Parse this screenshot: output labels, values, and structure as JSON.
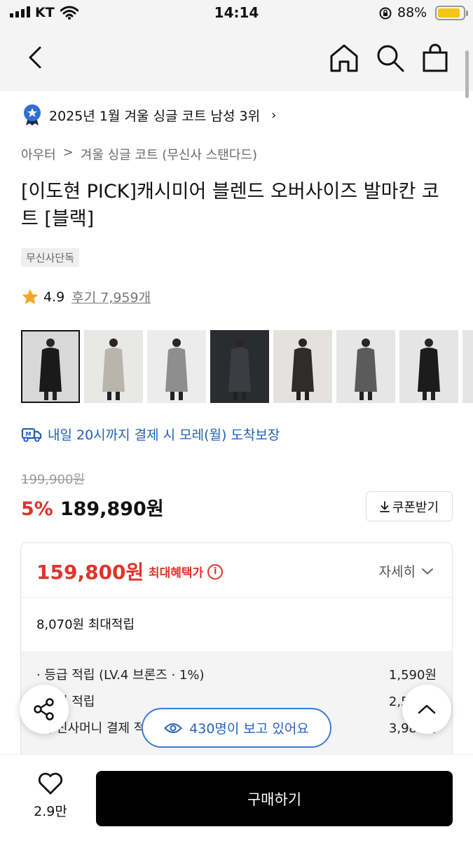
{
  "status": {
    "carrier": "KT",
    "time": "14:14",
    "battery_pct": "88%",
    "battery_level": 0.88
  },
  "nav": {
    "icons": [
      "back-icon",
      "home-icon",
      "search-icon",
      "bag-icon"
    ]
  },
  "ranking": {
    "text": "2025년 1월 겨울 싱글 코트 남성 3위"
  },
  "breadcrumb": {
    "level1": "아우터",
    "separator": ">",
    "level2": "겨울 싱글 코트 (무신사 스탠다드)"
  },
  "product": {
    "title": "[이도현 PICK]캐시미어 블렌드 오버사이즈 발마칸 코트 [블랙]",
    "tag": "무신사단독",
    "rating": "4.9",
    "review_label": "후기 7,959개"
  },
  "thumbnails": [
    {
      "label": "photo-1",
      "coat": "#1a1a1a",
      "bg": "#d8d8d8"
    },
    {
      "label": "photo-2",
      "coat": "#b8b5ac",
      "bg": "#e8e8e6"
    },
    {
      "label": "photo-3",
      "coat": "#8e8e8e",
      "bg": "#ececec"
    },
    {
      "label": "photo-4",
      "coat": "#3b3d42",
      "bg": "#2a2c30"
    },
    {
      "label": "photo-5",
      "coat": "#2f2c2b",
      "bg": "#e4e2df"
    },
    {
      "label": "photo-6",
      "coat": "#5b5b5b",
      "bg": "#e6e6e6"
    },
    {
      "label": "photo-7",
      "coat": "#1c1c1c",
      "bg": "#e5e5e5"
    },
    {
      "label": "photo-8",
      "coat": "#444444",
      "bg": "#e5e5e5"
    }
  ],
  "delivery": {
    "text": "내일 20시까지 결제 시 모레(월) 도착보장"
  },
  "price": {
    "original": "199,900원",
    "discount": "5%",
    "current": "189,890원",
    "coupon_button": "쿠폰받기"
  },
  "benefit": {
    "max_price": "159,800원",
    "max_label": "최대혜택가",
    "detail_label": "자세히",
    "max_points": "8,070원 최대적립",
    "points": [
      {
        "label": "· 등급 적립 (LV.4 브론즈 · 1%)",
        "value": "1,590원"
      },
      {
        "label": "· 후기 적립",
        "value": "2,500원"
      },
      {
        "label": "· 무신사머니 결제 적립",
        "value": "3,980원"
      }
    ]
  },
  "floating": {
    "viewers": "430명이 보고 있어요"
  },
  "bottom": {
    "like_count": "2.9만",
    "buy_button": "구매하기"
  },
  "colors": {
    "accent_red": "#e0342a",
    "accent_blue": "#1f5fb8",
    "star": "#f5a623"
  }
}
